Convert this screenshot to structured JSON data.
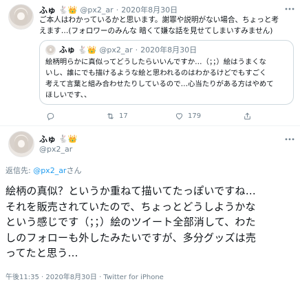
{
  "tweet1": {
    "display_name": "ふゅ",
    "name_emoji": "🐇👑",
    "handle": "@px2_ar",
    "separator": "·",
    "date": "2020年8月30日",
    "line1": "ご本人はわかっているかと思います。謝罪や説明がない場合、ちょっと考",
    "line2": "えます…(フォロワーのみんな 暗くて嫌な話を見せてしまいすみません)",
    "quote": {
      "display_name": "ふゅ",
      "name_emoji": "🐇👑",
      "handle": "@px2_ar",
      "separator": "·",
      "date": "2020年8月30日",
      "line1": "絵柄明らかに真似ってどうしたらいいんですか…（；；）絵はうまくな",
      "line2": "いし、誰にでも描けるような絵と思われるのはわかるけどでもすごく",
      "line3": "考えて言葉と組み合わせたりしているので…心当たりがある方はやめて",
      "line4": "ほしいです、、"
    },
    "actions": {
      "retweets": "17",
      "likes": "179"
    }
  },
  "tweet2": {
    "display_name": "ふゅ",
    "name_emoji": "🐇👑",
    "handle": "@px2_ar",
    "reply_prefix": "返信先: ",
    "reply_handle": "@px2_ar",
    "reply_suffix": "さん",
    "line1": "絵柄の真似？というか重ねて描いてたっぽいですね…",
    "line2": "それを販売されていたので、ちょっとどうしようかな",
    "line3": "という感じです（；；）絵のツイート全部消して、わた",
    "line4": "しのフォローも外したみたいですが、多分グッズは売",
    "line5": "ってたと思う…",
    "footer": "午後11:35 · 2020年8月30日 · Twitter for iPhone"
  }
}
